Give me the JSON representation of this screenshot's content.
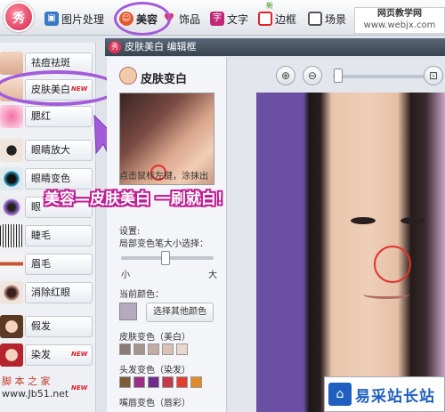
{
  "app": {
    "logo_text": "秀"
  },
  "tabs": [
    {
      "label": "图片处理",
      "icon": "image-icon",
      "color": "#3a78c4"
    },
    {
      "label": "美容",
      "icon": "makeup-face-icon",
      "color": "#e25a2f"
    },
    {
      "label": "饰品",
      "icon": "heart-icon",
      "color": "#e8325b"
    },
    {
      "label": "文字",
      "icon": "text-icon",
      "color": "#c2287a"
    },
    {
      "label": "边框",
      "icon": "frame-icon",
      "color": "#d6262b"
    },
    {
      "label": "场景",
      "icon": "scene-icon",
      "color": "#555555"
    },
    {
      "label": "",
      "icon": "stripes-icon",
      "color": "#7a54b8"
    }
  ],
  "tab_new_badge": "新",
  "watermark_top": {
    "line1": "网页教学网",
    "line2": "www.webjx.com"
  },
  "left_menu": [
    {
      "label": "祛痘祛斑",
      "new": ""
    },
    {
      "label": "皮肤美白",
      "new": "NEW"
    },
    {
      "label": "腮红",
      "new": ""
    },
    {
      "label": "眼睛放大",
      "new": ""
    },
    {
      "label": "眼睛变色",
      "new": ""
    },
    {
      "label": "眼",
      "new": ""
    },
    {
      "label": "睫毛",
      "new": ""
    },
    {
      "label": "眉毛",
      "new": ""
    },
    {
      "label": "消除红眼",
      "new": ""
    },
    {
      "label": "假发",
      "new": ""
    },
    {
      "label": "染发",
      "new": "NEW"
    },
    {
      "label": "",
      "new": "NEW"
    }
  ],
  "panel": {
    "title": "皮肤美白 编辑框",
    "heading": "皮肤变白",
    "hint": "点击鼠标左键，涂抹出",
    "settings_label": "设置:",
    "brush_label": "局部变色笔大小选择：",
    "slider_min": "小",
    "slider_max": "大",
    "slider_value": 0.48,
    "current_color_label": "当前颜色：",
    "current_color": "#b5a9c0",
    "other_color_button": "选择其他颜色",
    "groups": [
      {
        "label": "皮肤变色（美白）",
        "swatches": [
          "#8a7a74",
          "#a6938a",
          "#c4ada2",
          "#d8c2b6",
          "#e7d7cc"
        ]
      },
      {
        "label": "头发变色（染发）",
        "swatches": [
          "#7b5b3a",
          "#9b2f88",
          "#6f2c8e",
          "#c23a4e",
          "#e23d2f",
          "#e08a2a"
        ]
      },
      {
        "label": "嘴唇变色（唇彩）",
        "swatches": []
      }
    ]
  },
  "canvas": {
    "zoom_value": 0.05
  },
  "banner": "美容—皮肤美白 一刷就白！",
  "watermark_bl": {
    "line1": "脚 本 之 家",
    "line2": "www.Jb51.net"
  },
  "watermark_br": "易采站长站"
}
